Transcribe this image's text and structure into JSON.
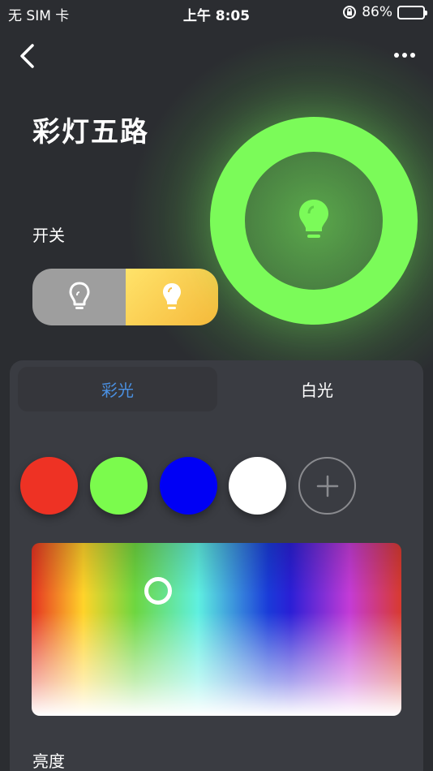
{
  "status_bar": {
    "carrier": "无 SIM 卡",
    "time": "上午 8:05",
    "battery": "86%",
    "battery_level": 0.86
  },
  "header": {
    "back_icon": "chevron-left-icon",
    "more_icon": "more-dots-icon"
  },
  "device": {
    "title": "彩灯五路",
    "switch_label": "开关",
    "ring_color": "#7bfb59"
  },
  "tabs": [
    {
      "label": "彩光",
      "active": true
    },
    {
      "label": "白光",
      "active": false
    }
  ],
  "swatches": [
    {
      "color": "#ee3224"
    },
    {
      "color": "#7bfb4d"
    },
    {
      "color": "#0000f5"
    },
    {
      "color": "#ffffff"
    }
  ],
  "add_icon": "plus-icon",
  "brightness_label": "亮度",
  "accent_color": "#4a90e2"
}
